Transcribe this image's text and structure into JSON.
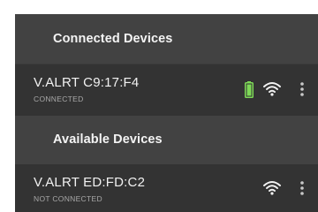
{
  "sections": {
    "connected": {
      "title": "Connected Devices",
      "devices": [
        {
          "name": "V.ALRT C9:17:F4",
          "status": "CONNECTED",
          "icons": [
            "battery-icon",
            "wifi-icon",
            "more-vert-icon"
          ],
          "battery_level": 1.0
        }
      ]
    },
    "available": {
      "title": "Available Devices",
      "devices": [
        {
          "name": "V.ALRT ED:FD:C2",
          "status": "NOT CONNECTED",
          "icons": [
            "wifi-icon",
            "more-vert-icon"
          ]
        }
      ]
    }
  },
  "colors": {
    "panel_bg": "#3b3b3b",
    "header_bg": "#424242",
    "row_bg": "#333333",
    "battery": "#7ed957",
    "icon": "#f2f2f2"
  }
}
